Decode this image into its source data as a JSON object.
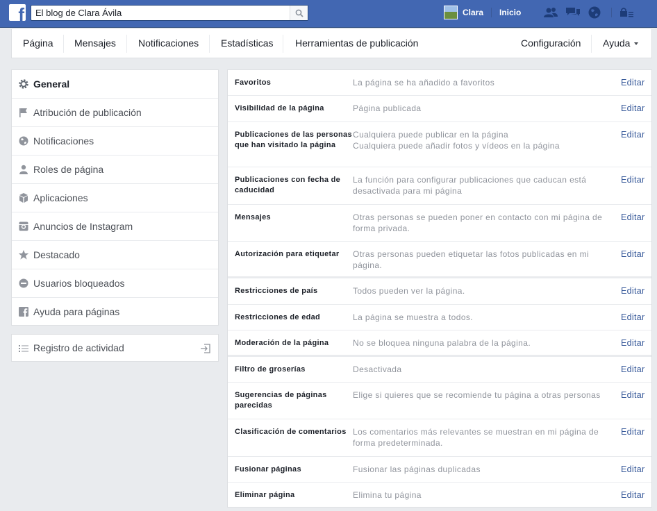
{
  "topbar": {
    "logo": "f",
    "search_value": "El blog de Clara Ávila",
    "user_name": "Clara",
    "home_label": "Inicio",
    "brand_color": "#4267b2",
    "icons": [
      "friend-requests-icon",
      "messages-icon",
      "notifications-globe-icon",
      "settings-lock-icon"
    ]
  },
  "subnav": {
    "items": [
      "Página",
      "Mensajes",
      "Notificaciones",
      "Estadísticas",
      "Herramientas de publicación"
    ],
    "settings_label": "Configuración",
    "help_label": "Ayuda"
  },
  "leftmenu": {
    "items": [
      {
        "label": "General",
        "icon": "gear-icon",
        "active": true
      },
      {
        "label": "Atribución de publicación",
        "icon": "flag-icon"
      },
      {
        "label": "Notificaciones",
        "icon": "globe-icon"
      },
      {
        "label": "Roles de página",
        "icon": "person-icon"
      },
      {
        "label": "Aplicaciones",
        "icon": "cube-icon"
      },
      {
        "label": "Anuncios de Instagram",
        "icon": "instagram-icon"
      },
      {
        "label": "Destacado",
        "icon": "star-icon"
      },
      {
        "label": "Usuarios bloqueados",
        "icon": "blocked-icon"
      },
      {
        "label": "Ayuda para páginas",
        "icon": "facebook-icon"
      }
    ],
    "activity_label": "Registro de actividad"
  },
  "settings": {
    "edit_label": "Editar",
    "rows": [
      {
        "name": "Favoritos",
        "desc": "La página se ha añadido a favoritos"
      },
      {
        "name": "Visibilidad de la página",
        "desc": "Página publicada"
      },
      {
        "name": "Publicaciones de las personas que han visitado la página",
        "desc": "Cualquiera puede publicar en la página\nCualquiera puede añadir fotos y vídeos en la página"
      },
      {
        "name": "Publicaciones con fecha de caducidad",
        "desc": "La función para configurar publicaciones que caducan está desactivada para mi página"
      },
      {
        "name": "Mensajes",
        "desc": "Otras personas se pueden poner en contacto con mi página de forma privada."
      },
      {
        "name": "Autorización para etiquetar",
        "desc": "Otras personas pueden etiquetar las fotos publicadas en mi página."
      },
      {
        "name": "Restricciones de país",
        "desc": "Todos pueden ver la página."
      },
      {
        "name": "Restricciones de edad",
        "desc": "La página se muestra a todos."
      },
      {
        "name": "Moderación de la página",
        "desc": "No se bloquea ninguna palabra de la página."
      },
      {
        "name": "Filtro de groserías",
        "desc": "Desactivada"
      },
      {
        "name": "Sugerencias de páginas parecidas",
        "desc": "Elige si quieres que se recomiende tu página a otras personas"
      },
      {
        "name": "Clasificación de comentarios",
        "desc": "Los comentarios más relevantes se muestran en mi página de forma predeterminada."
      },
      {
        "name": "Fusionar páginas",
        "desc": "Fusionar las páginas duplicadas"
      },
      {
        "name": "Eliminar página",
        "desc": "Elimina tu página"
      }
    ]
  }
}
